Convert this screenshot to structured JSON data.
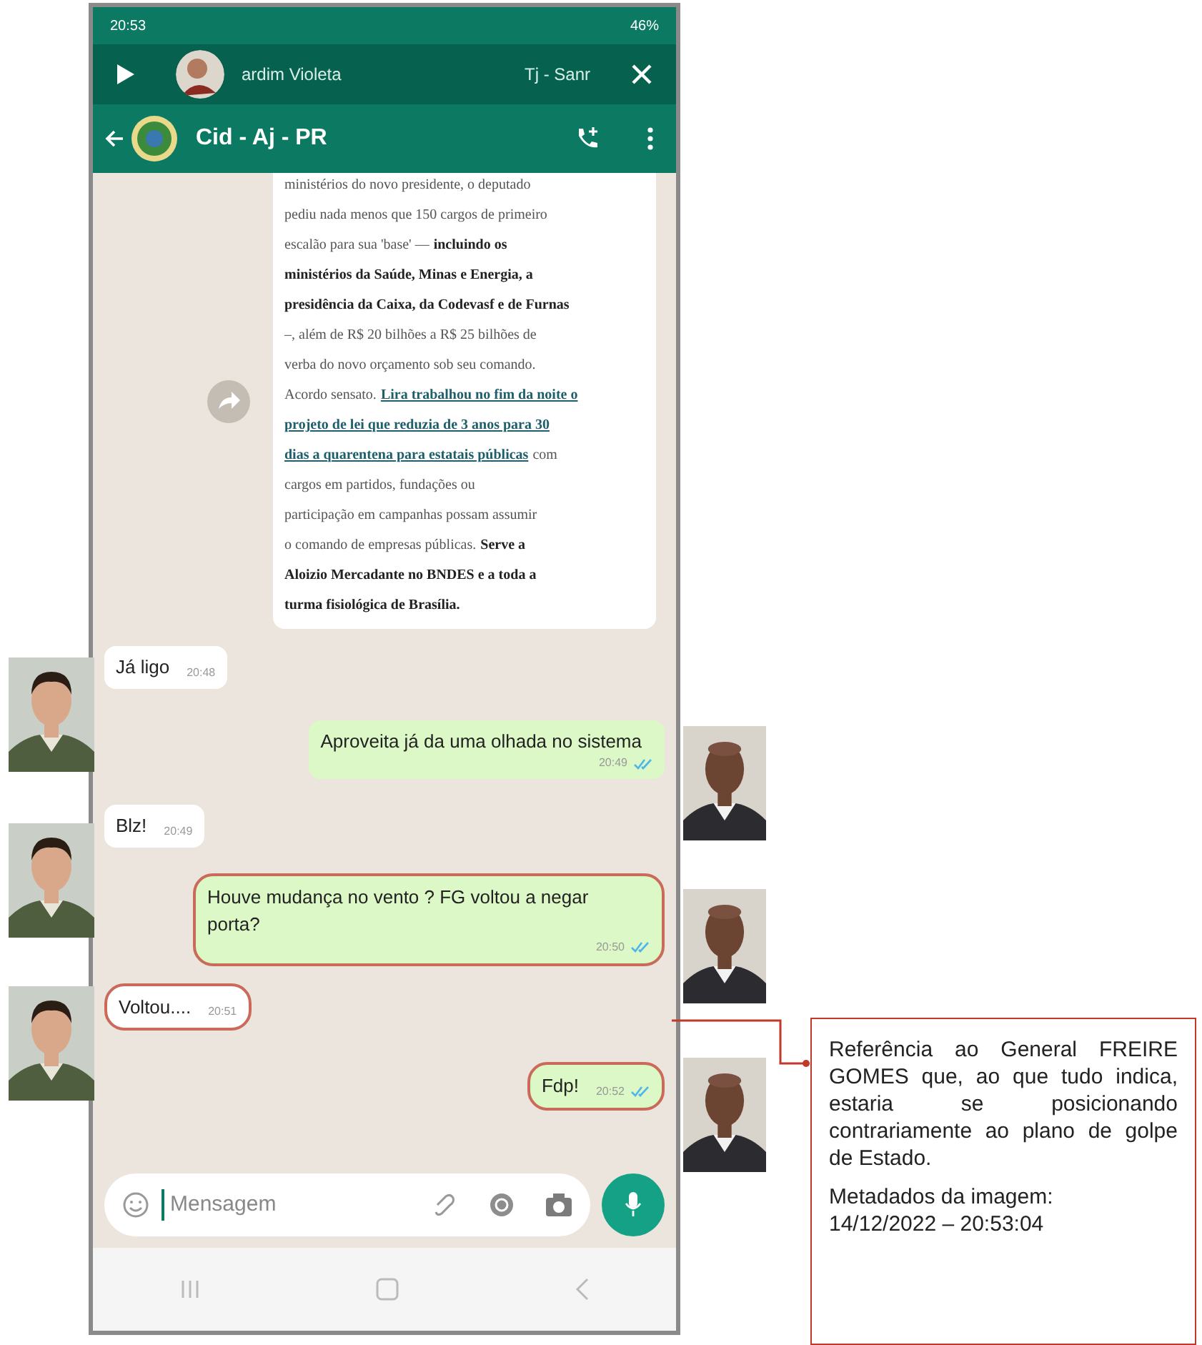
{
  "status_bar": {
    "time": "20:53",
    "battery": "46%"
  },
  "media_bar": {
    "title": "ardim Violeta",
    "subtitle": "Tj - Sanr"
  },
  "chat_header": {
    "title": "Cid - Aj - PR"
  },
  "forwarded_article": {
    "lines": [
      [
        {
          "kind": "plain",
          "text": "ministérios do novo presidente, o deputado"
        }
      ],
      [
        {
          "kind": "plain",
          "text": "pediu nada menos que 150 cargos de primeiro"
        }
      ],
      [
        {
          "kind": "plain",
          "text": "escalão para sua 'base' —"
        },
        {
          "kind": "bold",
          "text": "incluindo os"
        }
      ],
      [
        {
          "kind": "bold",
          "text": "ministérios da Saúde, Minas e Energia, a"
        }
      ],
      [
        {
          "kind": "bold",
          "text": "presidência da Caixa, da Codevasf e de Furnas"
        }
      ],
      [
        {
          "kind": "plain",
          "text": "–, além de R$ 20 bilhões a R$ 25 bilhões de"
        }
      ],
      [
        {
          "kind": "plain",
          "text": "verba do novo orçamento sob seu comando."
        }
      ],
      [
        {
          "kind": "plain",
          "text": "Acordo sensato."
        },
        {
          "kind": "link",
          "text": "Lira trabalhou no fim da noite o"
        }
      ],
      [
        {
          "kind": "link",
          "text": "projeto de lei que reduzia de 3 anos para 30"
        }
      ],
      [
        {
          "kind": "link",
          "text": "dias a quarentena para estatais públicas"
        },
        {
          "kind": "plain",
          "text": "com"
        }
      ],
      [
        {
          "kind": "plain",
          "text": "cargos em partidos, fundações ou"
        }
      ],
      [
        {
          "kind": "plain",
          "text": "participação em campanhas possam assumir"
        }
      ],
      [
        {
          "kind": "plain",
          "text": "o comando de empresas públicas."
        },
        {
          "kind": "bold",
          "text": "Serve a"
        }
      ],
      [
        {
          "kind": "bold",
          "text": "Aloizio Mercadante no BNDES e a toda a"
        }
      ],
      [
        {
          "kind": "bold",
          "text": "turma fisiológica de Brasília."
        }
      ]
    ]
  },
  "messages": [
    {
      "kind": "in",
      "text": "Já ligo",
      "time": "20:48",
      "highlighted": false
    },
    {
      "kind": "out",
      "text": "Aproveita já da uma olhada no sistema",
      "time": "20:49",
      "read": true,
      "highlighted": false
    },
    {
      "kind": "in",
      "text": "Blz!",
      "time": "20:49",
      "highlighted": false
    },
    {
      "kind": "out",
      "text": "Houve mudança no vento ? FG voltou a negar porta?",
      "time": "20:50",
      "read": true,
      "highlighted": true
    },
    {
      "kind": "in",
      "text": "Voltou....",
      "time": "20:51",
      "highlighted": true
    },
    {
      "kind": "out",
      "text": "Fdp!",
      "time": "20:52",
      "read": true,
      "highlighted": true
    }
  ],
  "composer": {
    "placeholder": "Mensagem"
  },
  "callout": {
    "text": "Referência ao General FREIRE GOMES que, ao que tudo indica, estaria se posicionando contrariamente ao plano de golpe de Estado.",
    "metadata_label": "Metadados da imagem:",
    "metadata_value": "14/12/2022 – 20:53:04"
  }
}
